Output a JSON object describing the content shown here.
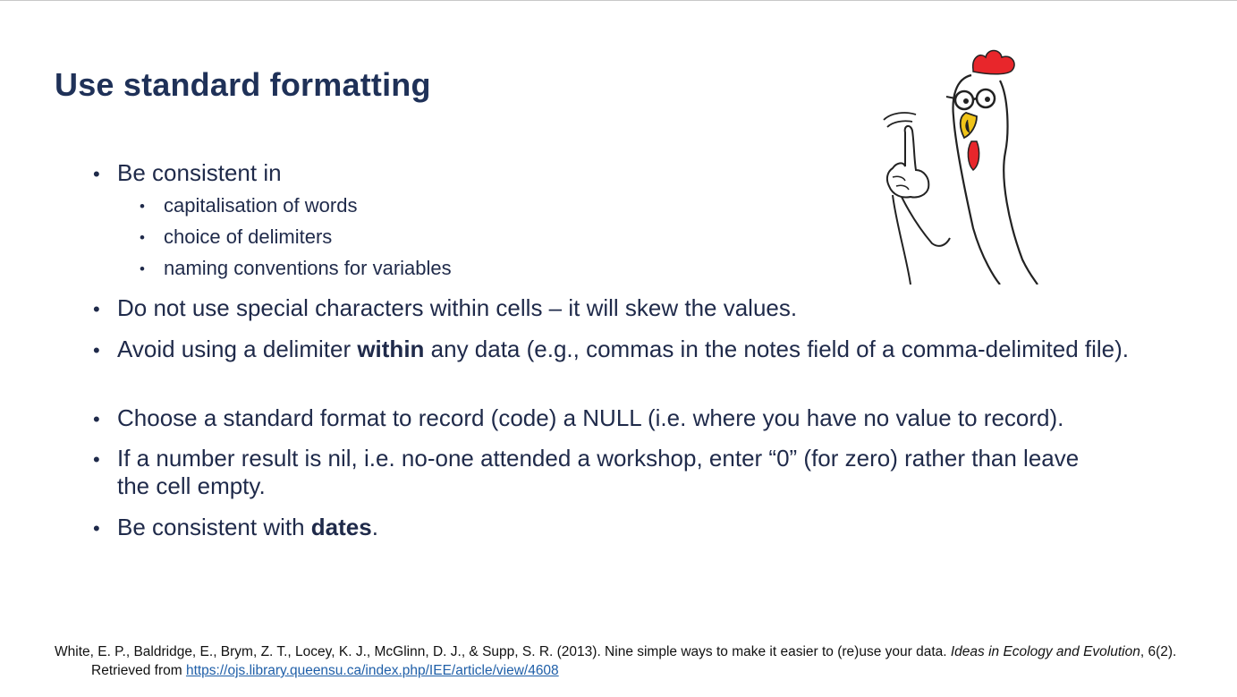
{
  "slide": {
    "title": "Use standard formatting"
  },
  "bullets": {
    "b1": "Be consistent in",
    "b1_sub": [
      "capitalisation of words",
      "choice of delimiters",
      "naming conventions for variables"
    ],
    "b2": "Do not use special characters within cells – it will skew the values.",
    "b3_pre": "Avoid using a delimiter ",
    "b3_bold": "within",
    "b3_post": " any data (e.g., commas in the notes field of a comma-delimited file).",
    "b4": "Choose a standard format to record (code) a NULL (i.e. where you have no value to record).",
    "b5": "If a number result is nil, i.e. no-one attended a workshop, enter “0” (for zero) rather than leave the cell empty.",
    "b6_pre": "Be consistent with ",
    "b6_bold": "dates",
    "b6_post": "."
  },
  "citation": {
    "main": "White, E. P., Baldridge, E., Brym, Z. T., Locey, K. J., McGlinn, D. J., & Supp, S. R. (2013). Nine simple ways to make it easier to (re)use your data. ",
    "journal": "Ideas in Ecology and Evolution",
    "tail": ", 6(2).",
    "retrieved": "Retrieved from ",
    "url": "https://ojs.library.queensu.ca/index.php/IEE/article/view/4608"
  },
  "colors": {
    "title": "#1f3158",
    "body_text": "#1f2a4a",
    "link": "#1f5fa8",
    "rooster_comb": "#e8262b"
  },
  "icons": {
    "bullet": "bullet-dot",
    "illustration": "cartoon-rooster-pointing"
  }
}
